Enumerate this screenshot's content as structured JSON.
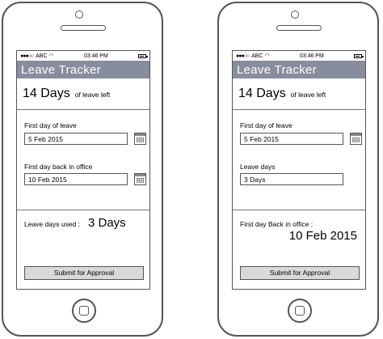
{
  "status_bar": {
    "carrier": "ABC",
    "time": "03:46 PM"
  },
  "app_title": "Leave Tracker",
  "leave_summary": {
    "days": "14 Days",
    "suffix": "of leave left"
  },
  "left_screen": {
    "first_day_label": "First day of leave",
    "first_day_value": "5 Feb 2015",
    "back_day_label": "First day back in office",
    "back_day_value": "10 Feb 2015",
    "used_label": "Leave days used :",
    "used_value": "3 Days",
    "submit_label": "Submit for Approval"
  },
  "right_screen": {
    "first_day_label": "First day of leave",
    "first_day_value": "5 Feb 2015",
    "leave_days_label": "Leave days",
    "leave_days_value": "3 Days",
    "back_label": "First day Back in office :",
    "back_value": "10 Feb 2015",
    "submit_label": "Submit for Approval"
  },
  "icons": {
    "calendar": "calendar-icon",
    "home": "home-button-icon",
    "wifi": "wifi-icon",
    "battery": "battery-icon"
  }
}
